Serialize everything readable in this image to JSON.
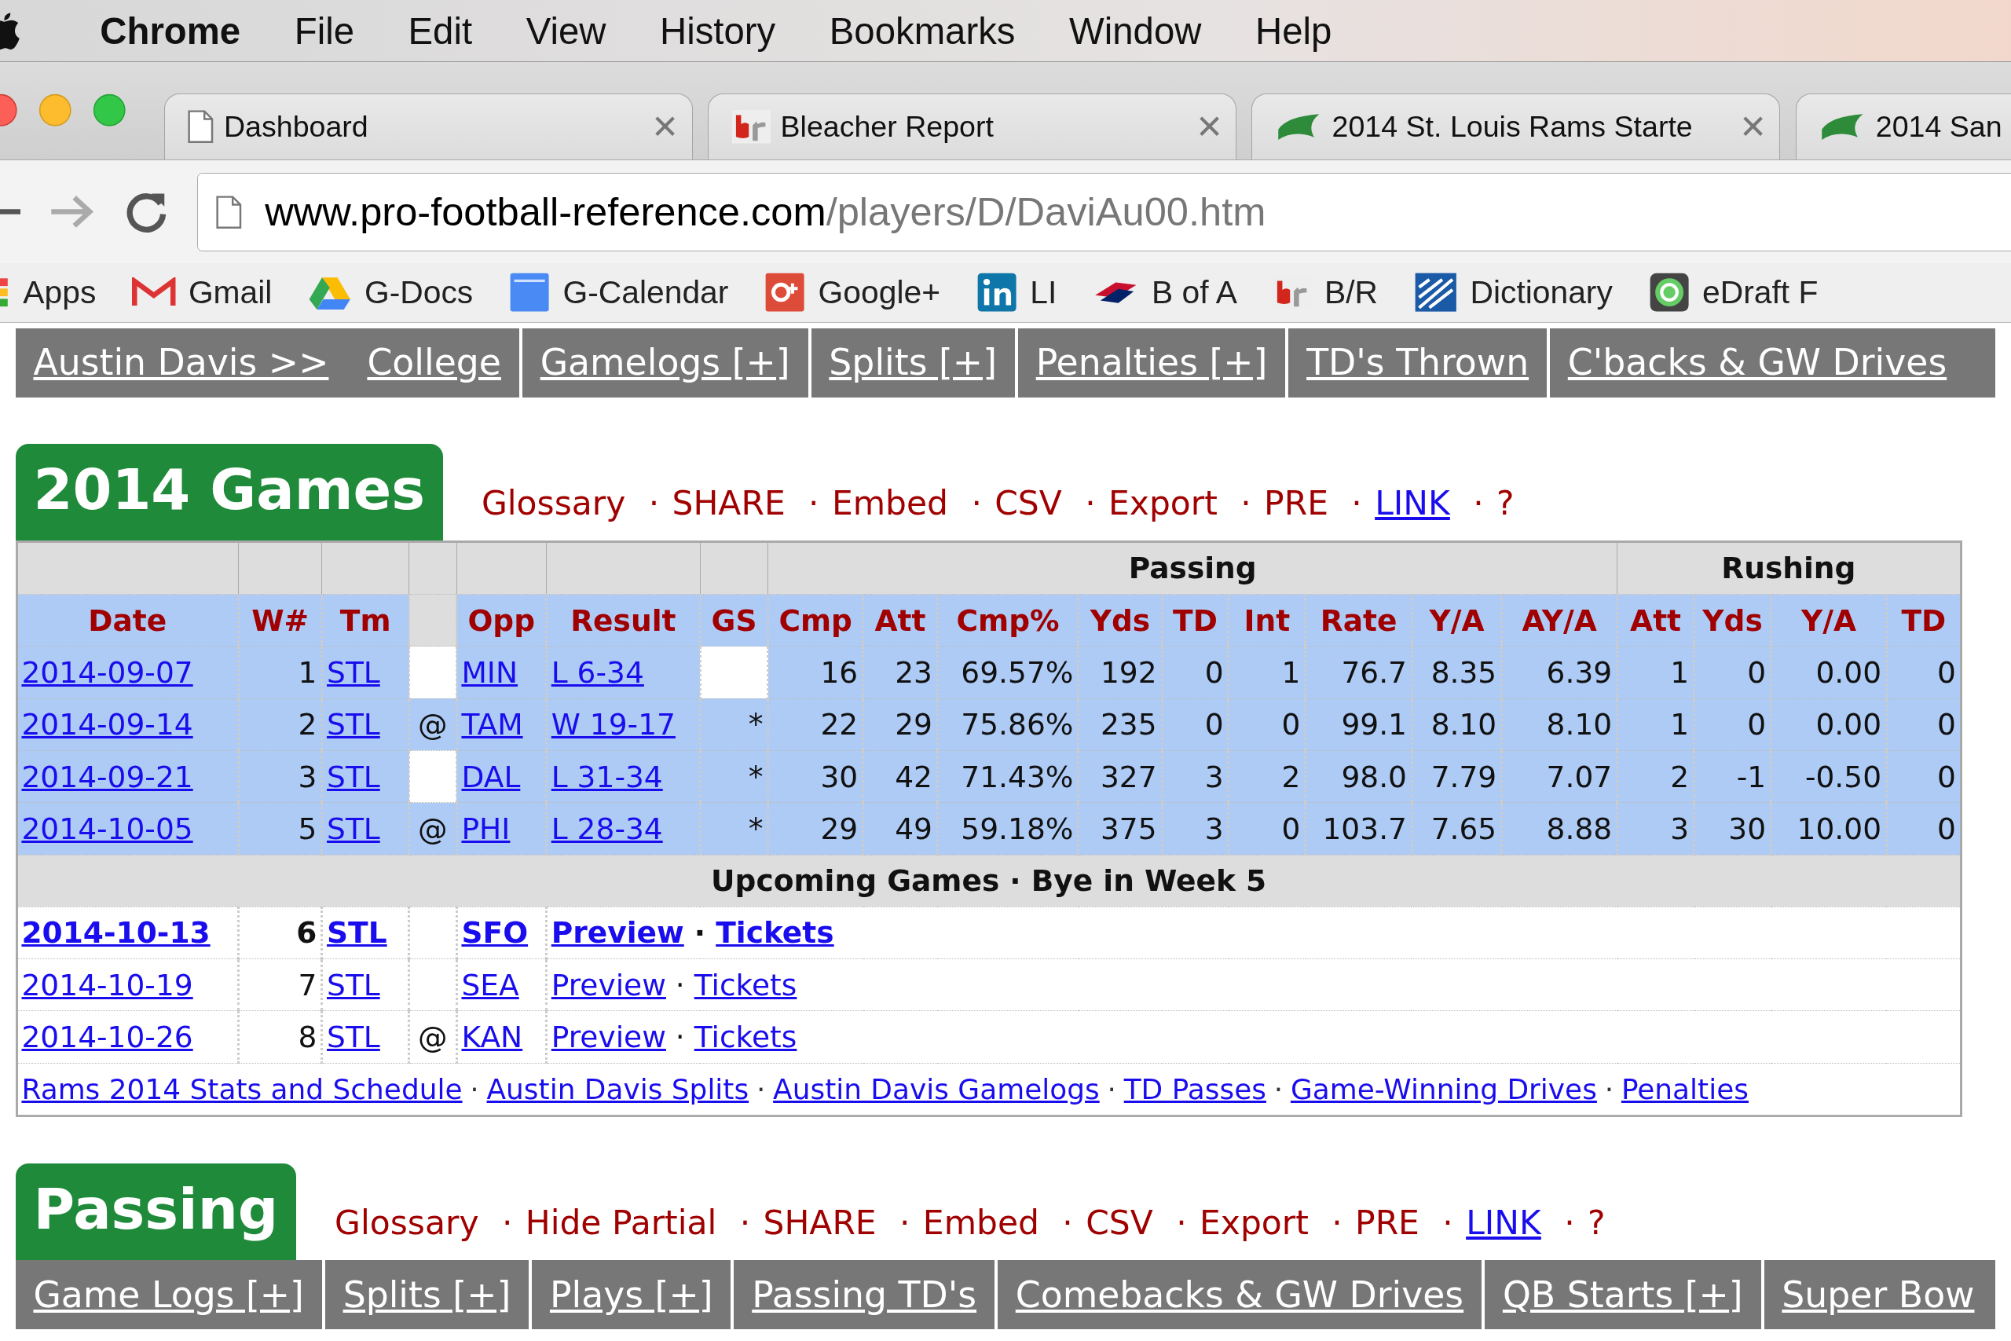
{
  "menu_bar": {
    "app": "Chrome",
    "items": [
      "File",
      "Edit",
      "View",
      "History",
      "Bookmarks",
      "Window",
      "Help"
    ]
  },
  "tabs": [
    {
      "title": "Dashboard",
      "close": "✕",
      "selected": false
    },
    {
      "title": "Bleacher Report",
      "close": "✕",
      "selected": false
    },
    {
      "title": "2014 St. Louis Rams Starte",
      "close": "✕",
      "selected": false
    },
    {
      "title": "2014 San",
      "selected": false
    }
  ],
  "address_bar": {
    "host": "www.pro-football-reference.com",
    "path": "/players/D/DaviAu00.htm"
  },
  "bookmarks": [
    "Apps",
    "Gmail",
    "G-Docs",
    "G-Calendar",
    "Google+",
    "LI",
    "B of A",
    "B/R",
    "Dictionary",
    "eDraft F"
  ],
  "nav": [
    [
      "Austin Davis >>",
      "College"
    ],
    [
      "Gamelogs [+]"
    ],
    [
      "Splits [+]"
    ],
    [
      "Penalties [+]"
    ],
    [
      "TD's Thrown"
    ],
    [
      "C'backs & GW Drives"
    ]
  ],
  "separator": "·",
  "games_section": {
    "title": "2014 Games",
    "actions": [
      {
        "label": "Glossary",
        "kind": "action"
      },
      {
        "label": "SHARE",
        "kind": "action"
      },
      {
        "label": "Embed",
        "kind": "action"
      },
      {
        "label": "CSV",
        "kind": "action"
      },
      {
        "label": "Export",
        "kind": "action"
      },
      {
        "label": "PRE",
        "kind": "action"
      },
      {
        "label": "LINK",
        "kind": "link"
      },
      {
        "label": "?",
        "kind": "action"
      }
    ],
    "table": {
      "header_selected": true,
      "column_groups": [
        {
          "columns": [
            {
              "label": "Date",
              "link": true
            },
            {
              "label": "W#",
              "link": false
            },
            {
              "label": "Tm",
              "link": true
            },
            {
              "link": false
            },
            {
              "label": "Opp",
              "link": true
            },
            {
              "label": "Result",
              "link": true
            },
            {
              "label": "GS",
              "link": false
            }
          ]
        },
        {
          "label": "Passing",
          "columns": [
            {
              "label": "Cmp",
              "link": false
            },
            {
              "label": "Att",
              "link": false
            },
            {
              "label": "Cmp%",
              "link": false
            },
            {
              "label": "Yds",
              "link": false
            },
            {
              "label": "TD",
              "link": false
            },
            {
              "label": "Int",
              "link": false
            },
            {
              "label": "Rate",
              "link": false
            },
            {
              "label": "Y/A",
              "link": false
            },
            {
              "label": "AY/A",
              "link": false
            }
          ]
        },
        {
          "label": "Rushing",
          "columns": [
            {
              "label": "Att",
              "link": false
            },
            {
              "label": "Yds",
              "link": false
            },
            {
              "label": "Y/A",
              "link": false
            },
            {
              "label": "TD",
              "link": false
            }
          ]
        }
      ],
      "rows": [
        {
          "selected": true,
          "cells": [
            "2014-09-07",
            "1",
            "STL",
            null,
            "MIN",
            "L 6-34",
            null,
            "16",
            "23",
            "69.57%",
            "192",
            "0",
            "1",
            "76.7",
            "8.35",
            "6.39",
            "1",
            "0",
            "0.00",
            "0"
          ]
        },
        {
          "selected": true,
          "cells": [
            "2014-09-14",
            "2",
            "STL",
            "@",
            "TAM",
            "W 19-17",
            "*",
            "22",
            "29",
            "75.86%",
            "235",
            "0",
            "0",
            "99.1",
            "8.10",
            "8.10",
            "1",
            "0",
            "0.00",
            "0"
          ]
        },
        {
          "selected": true,
          "cells": [
            "2014-09-21",
            "3",
            "STL",
            null,
            "DAL",
            "L 31-34",
            "*",
            "30",
            "42",
            "71.43%",
            "327",
            "3",
            "2",
            "98.0",
            "7.79",
            "7.07",
            "2",
            "-1",
            "-0.50",
            "0"
          ]
        },
        {
          "selected": true,
          "cells": [
            "2014-10-05",
            "5",
            "STL",
            "@",
            "PHI",
            "L 28-34",
            "*",
            "29",
            "49",
            "59.18%",
            "375",
            "3",
            "0",
            "103.7",
            "7.65",
            "8.88",
            "3",
            "30",
            "10.00",
            "0"
          ]
        }
      ],
      "upcoming": {
        "title": "Upcoming Games · Bye in Week 5",
        "rows": [
          {
            "bold": true,
            "date": "2014-10-13",
            "week": "6",
            "team": "STL",
            "opp": "SFO",
            "links": [
              "Preview",
              "Tickets"
            ]
          },
          {
            "bold": false,
            "date": "2014-10-19",
            "week": "7",
            "team": "STL",
            "opp": "SEA",
            "links": [
              "Preview",
              "Tickets"
            ]
          },
          {
            "bold": false,
            "date": "2014-10-26",
            "week": "8",
            "team": "STL",
            "at": "@",
            "opp": "KAN",
            "links": [
              "Preview",
              "Tickets"
            ]
          }
        ]
      },
      "footer_links": [
        "Rams 2014 Stats and Schedule",
        "Austin Davis Splits",
        "Austin Davis Gamelogs",
        "TD Passes",
        "Game-Winning Drives",
        "Penalties"
      ]
    }
  },
  "passing_section": {
    "title": "Passing",
    "actions": [
      {
        "label": "Glossary",
        "kind": "action"
      },
      {
        "label": "Hide Partial",
        "kind": "action"
      },
      {
        "label": "SHARE",
        "kind": "action"
      },
      {
        "label": "Embed",
        "kind": "action"
      },
      {
        "label": "CSV",
        "kind": "action"
      },
      {
        "label": "Export",
        "kind": "action"
      },
      {
        "label": "PRE",
        "kind": "action"
      },
      {
        "label": "LINK",
        "kind": "link"
      },
      {
        "label": "?",
        "kind": "action"
      }
    ],
    "nav": [
      [
        "Game Logs [+]"
      ],
      [
        "Splits [+]"
      ],
      [
        "Plays [+]"
      ],
      [
        "Passing TD's"
      ],
      [
        "Comebacks & GW Drives"
      ],
      [
        "QB Starts [+]"
      ],
      [
        "Super Bow"
      ]
    ]
  }
}
